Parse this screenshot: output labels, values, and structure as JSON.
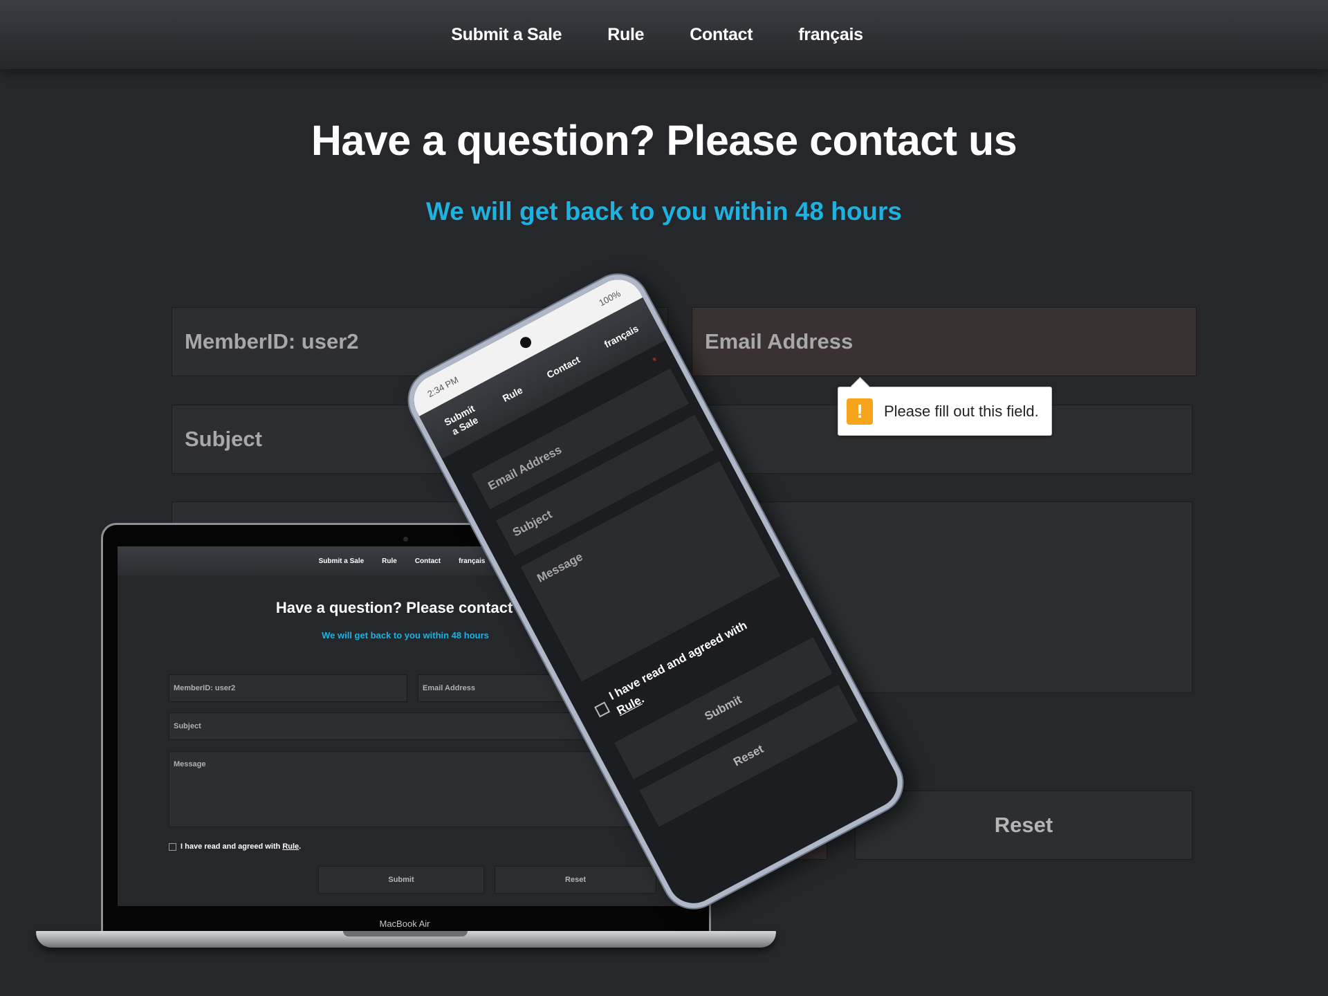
{
  "nav": {
    "items": [
      "Submit a Sale",
      "Rule",
      "Contact",
      "français"
    ]
  },
  "header": {
    "title": "Have a question? Please contact us",
    "subtitle": "We will get back to you within 48 hours"
  },
  "form": {
    "member_id": "MemberID: user2",
    "email_placeholder": "Email Address",
    "subject_placeholder": "Subject",
    "reset_label": "Reset",
    "validation_tooltip": "Please fill out this field.",
    "warning_glyph": "!"
  },
  "laptop": {
    "nav": [
      "Submit a Sale",
      "Rule",
      "Contact",
      "français"
    ],
    "title": "Have a question? Please contact us",
    "subtitle": "We will get back to you within 48 hours",
    "member_id": "MemberID: user2",
    "email": "Email Address",
    "subject": "Subject",
    "message": "Message",
    "agree_text": "I have read and agreed with ",
    "agree_link": "Rule",
    "agree_end": ".",
    "submit": "Submit",
    "reset": "Reset",
    "brand": "MacBook Air"
  },
  "phone": {
    "time": "2:34 PM",
    "battery": "100%",
    "nav": [
      "Submit a Sale",
      "Rule",
      "Contact",
      "français"
    ],
    "required_mark": "*",
    "email": "Email Address",
    "subject": "Subject",
    "message": "Message",
    "agree_text": "I have read and agreed with ",
    "agree_link": "Rule",
    "agree_end": ".",
    "submit": "Submit",
    "reset": "Reset"
  },
  "colors": {
    "background": "#25272a",
    "accent": "#1fb2e1",
    "warning": "#f6a41b",
    "invalid_field": "#3a3132"
  }
}
